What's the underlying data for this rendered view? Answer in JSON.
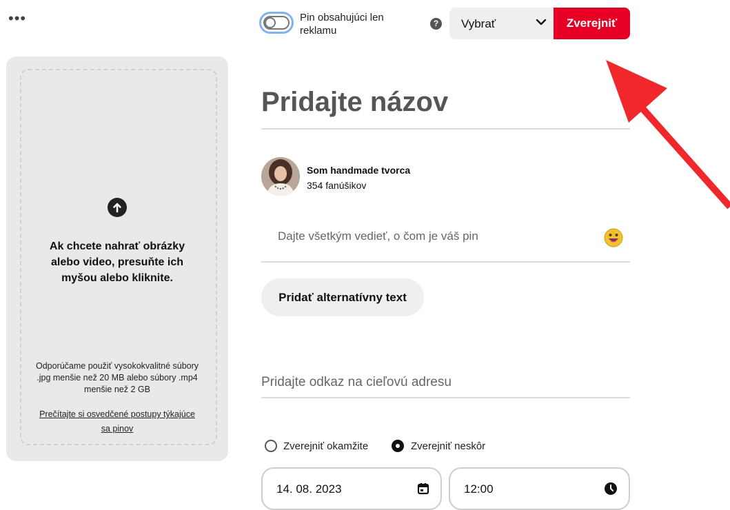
{
  "header": {
    "more_label": "•••",
    "toggle_label": "Pin obsahujúci len reklamu",
    "help_label": "?",
    "board_select_value": "Vybrať",
    "publish_label": "Zverejniť",
    "accent_color": "#e60023",
    "annotation_arrow_color": "#f0282b"
  },
  "upload": {
    "icon": "upload-arrow-icon",
    "text": "Ak chcete nahrať obrázky alebo video, presuňte ich myšou alebo kliknite.",
    "hint": "Odporúčame použiť vysokokvalitné súbory .jpg menšie než 20 MB alebo súbory .mp4 menšie než 2 GB",
    "link": "Prečítajte si osvedčené postupy týkajúce sa pinov"
  },
  "form": {
    "title_placeholder": "Pridajte názov",
    "user": {
      "name": "Som handmade tvorca",
      "followers": "354 fanúšikov"
    },
    "description_placeholder": "Dajte všetkým vedieť, o čom je váš pin",
    "alt_text_button": "Pridať alternatívny text",
    "link_placeholder": "Pridajte odkaz na cieľovú adresu",
    "publish_options": [
      {
        "label": "Zverejniť okamžite",
        "selected": false
      },
      {
        "label": "Zverejniť neskôr",
        "selected": true
      }
    ],
    "date_value": "14. 08. 2023",
    "time_value": "12:00"
  }
}
